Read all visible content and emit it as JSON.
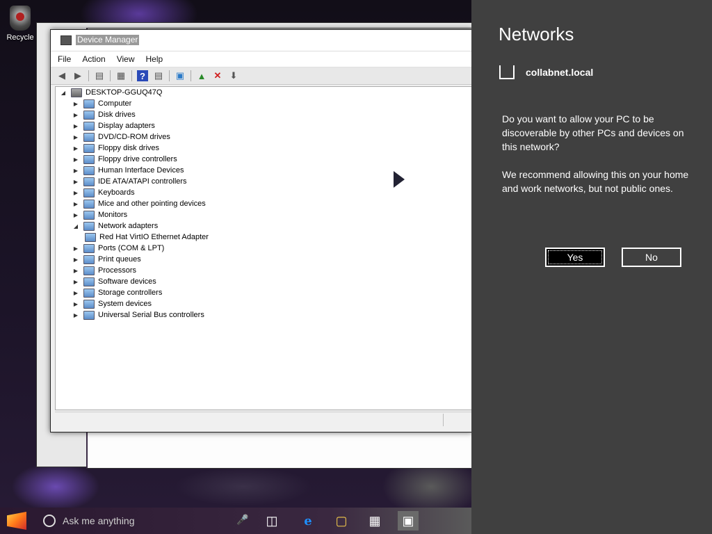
{
  "desktop": {
    "recycle_bin_label": "Recycle"
  },
  "device_manager": {
    "title": "Device Manager",
    "menu": [
      "File",
      "Action",
      "View",
      "Help"
    ],
    "toolbar_icons": [
      "back-icon",
      "forward-icon",
      "properties-icon",
      "show-hide-console-tree-icon",
      "help-icon",
      "view-icon",
      "monitor-icon",
      "update-driver-icon",
      "uninstall-icon",
      "scan-hardware-icon"
    ],
    "tree": {
      "root": "DESKTOP-GGUQ47Q",
      "items": [
        {
          "label": "Computer",
          "expanded": false
        },
        {
          "label": "Disk drives",
          "expanded": false
        },
        {
          "label": "Display adapters",
          "expanded": false
        },
        {
          "label": "DVD/CD-ROM drives",
          "expanded": false
        },
        {
          "label": "Floppy disk drives",
          "expanded": false
        },
        {
          "label": "Floppy drive controllers",
          "expanded": false
        },
        {
          "label": "Human Interface Devices",
          "expanded": false
        },
        {
          "label": "IDE ATA/ATAPI controllers",
          "expanded": false
        },
        {
          "label": "Keyboards",
          "expanded": false
        },
        {
          "label": "Mice and other pointing devices",
          "expanded": false
        },
        {
          "label": "Monitors",
          "expanded": false
        },
        {
          "label": "Network adapters",
          "expanded": true
        },
        {
          "label": "Red Hat VirtIO Ethernet Adapter",
          "child": true
        },
        {
          "label": "Ports (COM & LPT)",
          "expanded": false
        },
        {
          "label": "Print queues",
          "expanded": false
        },
        {
          "label": "Processors",
          "expanded": false
        },
        {
          "label": "Software devices",
          "expanded": false
        },
        {
          "label": "Storage controllers",
          "expanded": false
        },
        {
          "label": "System devices",
          "expanded": false
        },
        {
          "label": "Universal Serial Bus controllers",
          "expanded": false
        }
      ]
    }
  },
  "taskbar": {
    "search_placeholder": "Ask me anything"
  },
  "networks": {
    "title": "Networks",
    "network_name": "collabnet.local",
    "question": "Do you want to allow your PC to be discoverable by other PCs and devices on this network?",
    "recommendation": "We recommend allowing this on your home and work networks, but not public ones.",
    "yes_label": "Yes",
    "no_label": "No"
  }
}
